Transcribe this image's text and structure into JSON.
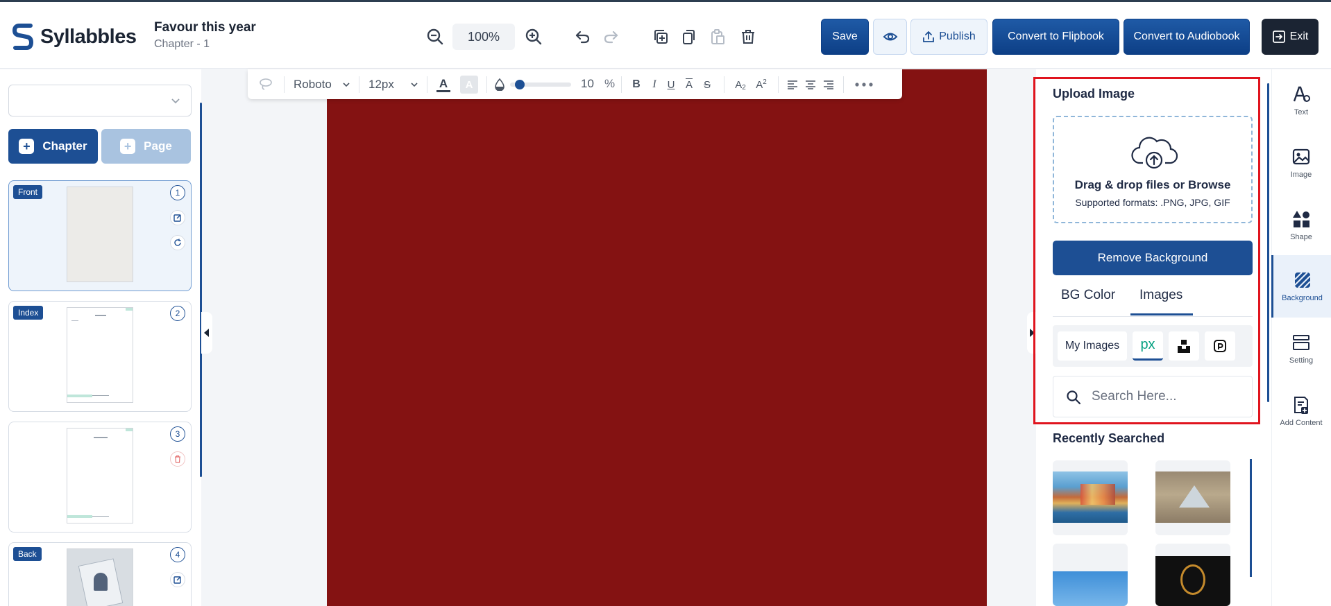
{
  "app": {
    "brand": "Syllabbles",
    "doc_title": "Favour this year",
    "doc_subtitle": "Chapter - 1"
  },
  "header": {
    "zoom": "100%",
    "save": "Save",
    "publish": "Publish",
    "flipbook": "Convert to Flipbook",
    "audiobook": "Convert to Audiobook",
    "exit": "Exit"
  },
  "sidebar": {
    "dropdown_value": "",
    "chapter_btn": "Chapter",
    "page_btn": "Page",
    "pages": [
      {
        "label": "Front",
        "number": "1"
      },
      {
        "label": "Index",
        "number": "2"
      },
      {
        "label": "",
        "number": "3"
      },
      {
        "label": "Back",
        "number": "4"
      }
    ]
  },
  "toolbar": {
    "font": "Roboto",
    "size": "12px",
    "opacity": "10",
    "percent": "%",
    "opacity_level": 0.1
  },
  "panel": {
    "upload_title": "Upload Image",
    "drop_title": "Drag & drop files or Browse",
    "drop_formats": "Supported formats: .PNG, JPG, GIF",
    "remove_bg": "Remove Background",
    "tab_bg_color": "BG Color",
    "tab_images": "Images",
    "my_images": "My Images",
    "search_placeholder": "Search Here...",
    "recent_title": "Recently Searched"
  },
  "rail": [
    {
      "label": "Text",
      "icon": "text-icon"
    },
    {
      "label": "Image",
      "icon": "image-icon"
    },
    {
      "label": "Shape",
      "icon": "shape-icon"
    },
    {
      "label": "Background",
      "icon": "background-icon"
    },
    {
      "label": "Setting",
      "icon": "setting-icon"
    },
    {
      "label": "Add Content",
      "icon": "add-content-icon"
    }
  ],
  "colors": {
    "brand_blue": "#1d4f94",
    "page_red": "#841212",
    "highlight": "#e0141e"
  }
}
